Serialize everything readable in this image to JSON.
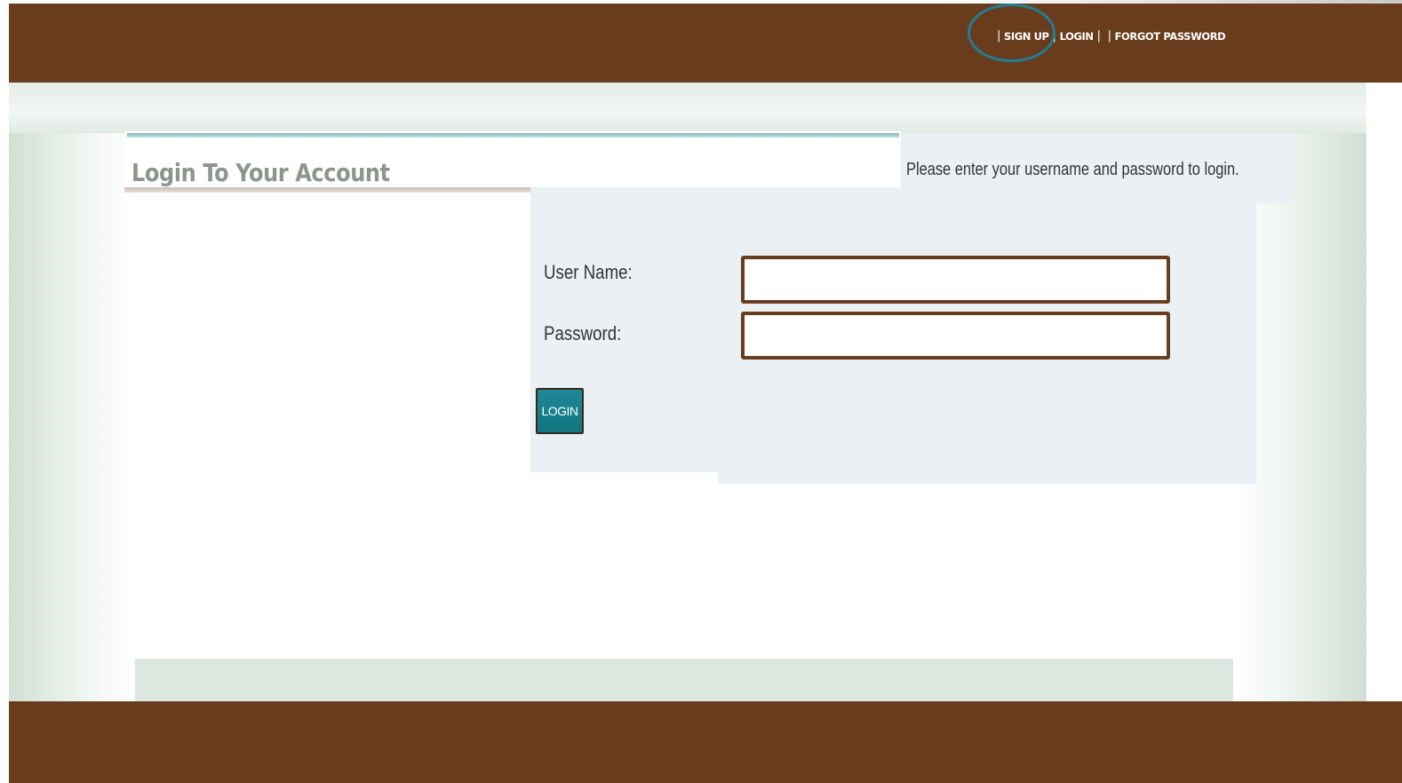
{
  "nav": {
    "separator": "|",
    "signup_label": "SIGN UP",
    "login_label": "LOGIN",
    "forgot_label": "FORGOT PASSWORD"
  },
  "header": {
    "title": "Login To Your Account",
    "instructions": "Please enter your username and password to login."
  },
  "form": {
    "username_label": "User Name:",
    "username_value": "",
    "password_label": "Password:",
    "password_value": "",
    "submit_label": "LOGIN"
  },
  "colors": {
    "brand_brown": "#6a3c1e",
    "accent_teal": "#127581",
    "highlight_circle": "#1f7f93",
    "panel_bg": "#ebf0f4"
  }
}
